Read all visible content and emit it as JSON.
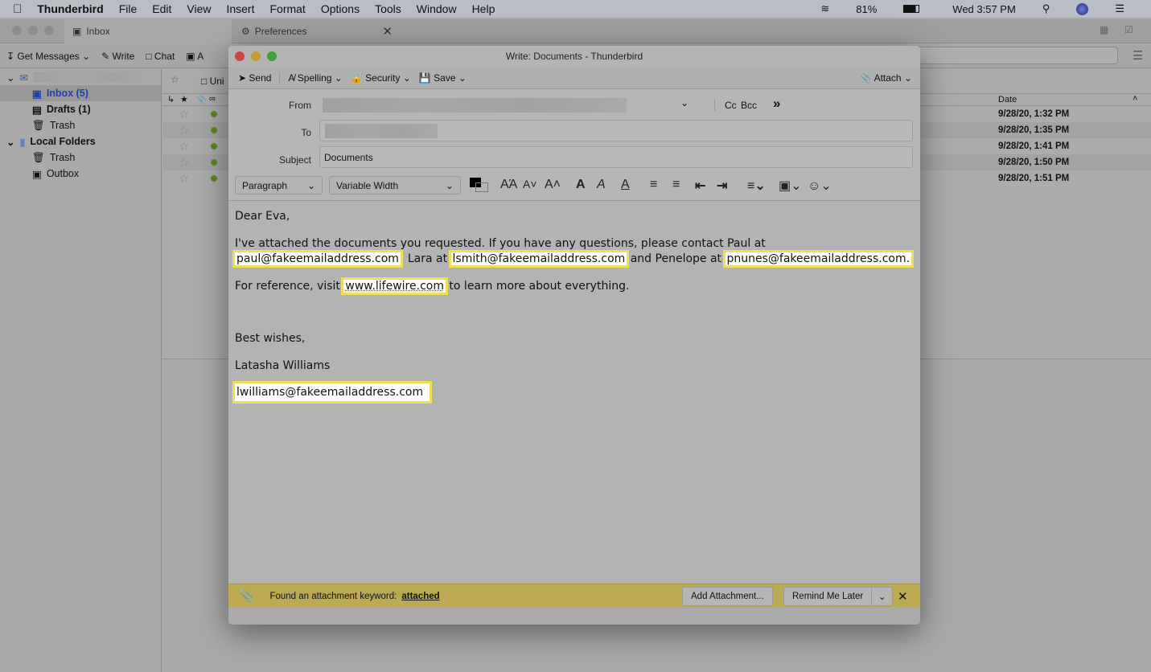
{
  "menubar": {
    "app": "Thunderbird",
    "items": [
      "File",
      "Edit",
      "View",
      "Insert",
      "Format",
      "Options",
      "Tools",
      "Window",
      "Help"
    ],
    "battery": "81%",
    "clock": "Wed 3:57 PM"
  },
  "tabs": [
    {
      "label": "Inbox"
    },
    {
      "label": "Preferences"
    }
  ],
  "toolbar": {
    "get_messages": "Get Messages",
    "write": "Write",
    "chat": "Chat",
    "address": "A"
  },
  "folders": [
    {
      "label": "Inbox (5)"
    },
    {
      "label": "Drafts (1)"
    },
    {
      "label": "Trash"
    },
    {
      "label": "Local Folders"
    },
    {
      "label": "Trash"
    },
    {
      "label": "Outbox"
    }
  ],
  "list": {
    "quickfilter_unread": "Uni",
    "date_header": "Date",
    "dates": [
      "9/28/20, 1:32 PM",
      "9/28/20, 1:35 PM",
      "9/28/20, 1:41 PM",
      "9/28/20, 1:50 PM",
      "9/28/20, 1:51 PM"
    ]
  },
  "compose": {
    "title": "Write: Documents - Thunderbird",
    "toolbar": {
      "send": "Send",
      "spelling": "Spelling",
      "security": "Security",
      "save": "Save",
      "attach": "Attach"
    },
    "labels": {
      "from": "From",
      "to": "To",
      "subject": "Subject",
      "cc": "Cc",
      "bcc": "Bcc"
    },
    "subject": "Documents",
    "format": {
      "paragraph": "Paragraph",
      "font": "Variable Width"
    },
    "body": {
      "greeting": "Dear Eva,",
      "p1a": "I've attached the documents you requested. If you have any questions, please contact Paul at ",
      "email_paul": "paul@fakeemailaddress.com",
      "p1b": ", Lara at ",
      "email_lara": "lsmith@fakeemailaddress.com",
      "p1c": " and Penelope at ",
      "email_penelope": "pnunes@fakeemailaddress.com.",
      "p2a": "For reference, visit ",
      "link": "www.lifewire.com",
      "p2b": " to learn more about everything.",
      "closing": "Best wishes,",
      "name": "Latasha Williams",
      "email_sig": "lwilliams@fakeemailaddress.com"
    },
    "notification": {
      "text": "Found an attachment keyword:",
      "keyword": "attached",
      "add": "Add Attachment...",
      "remind": "Remind Me Later",
      "highlight": "#f0dd5a"
    }
  }
}
